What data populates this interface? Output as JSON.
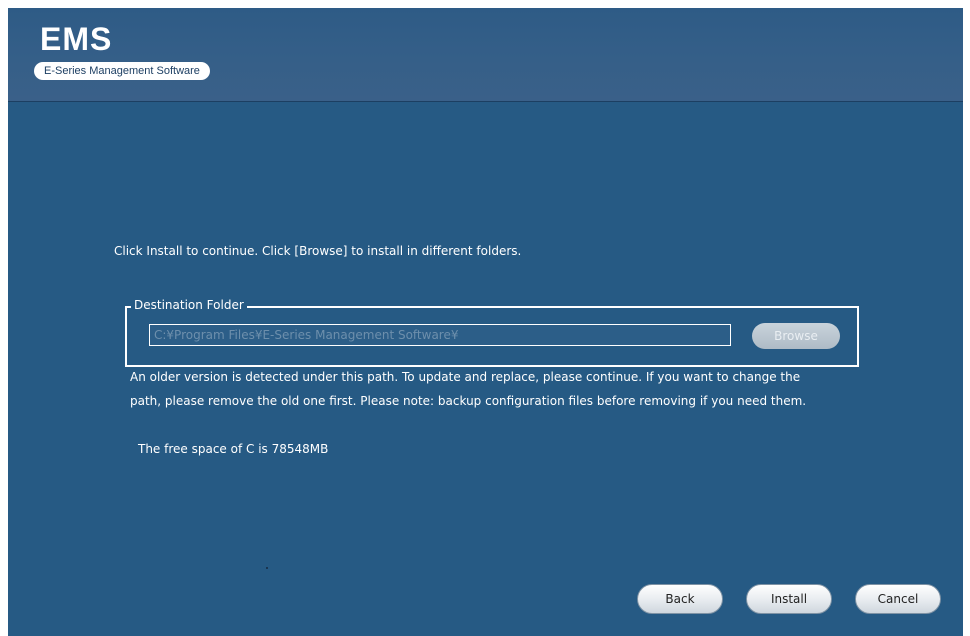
{
  "header": {
    "title": "EMS",
    "subtitle": "E-Series Management Software"
  },
  "instruction": "Click Install to continue. Click [Browse] to install in different folders.",
  "destination": {
    "legend": "Destination Folder",
    "path_value": "C:¥Program Files¥E-Series Management Software¥",
    "browse_label": "Browse"
  },
  "notes": {
    "line1": "An older version is detected under this path. To update and replace, please continue. If you want to change the",
    "line2": "path, please remove the old one first. Please note: backup configuration files before removing if you need them."
  },
  "free_space": "The free space of C is 78548MB",
  "buttons": {
    "back": "Back",
    "install": "Install",
    "cancel": "Cancel"
  },
  "colors": {
    "background": "#265a84",
    "header": "#355f88",
    "text": "#ffffff"
  }
}
